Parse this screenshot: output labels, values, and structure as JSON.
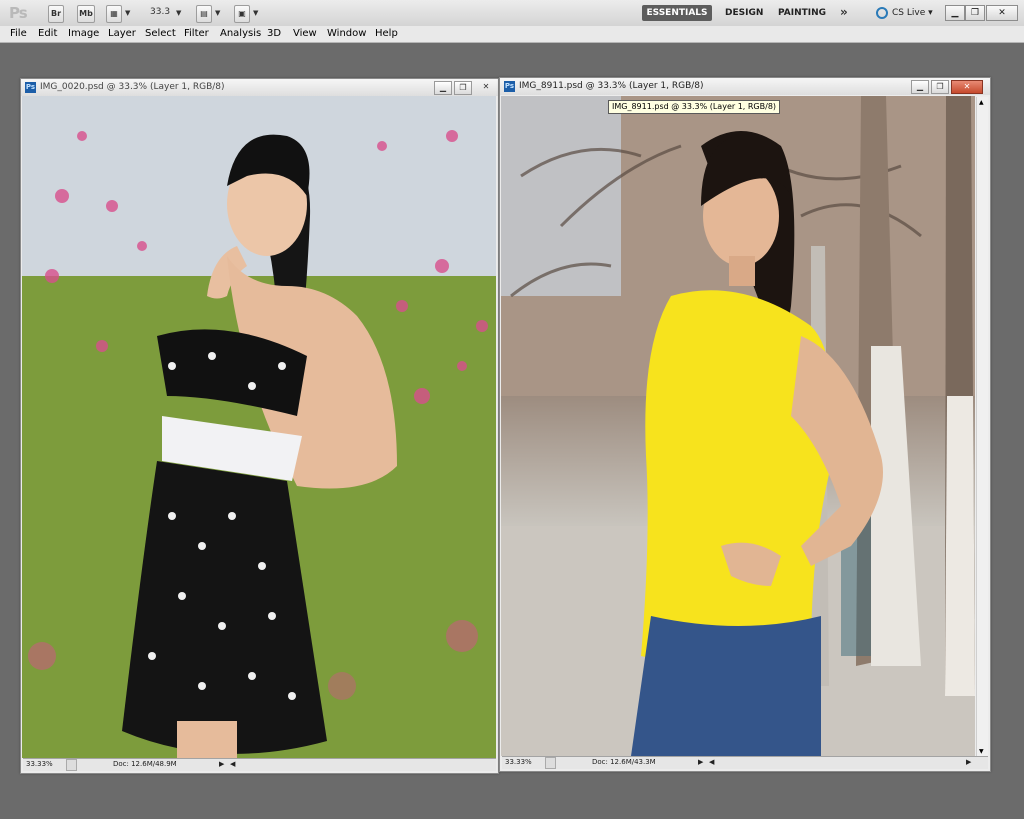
{
  "app": {
    "logo": "Ps",
    "zoom_value": "33.3",
    "toolbar_icons": [
      "br",
      "mb",
      "view-extras",
      "arrange-documents",
      "screen-mode"
    ],
    "workspace": {
      "active": "ESSENTIALS",
      "others": [
        "DESIGN",
        "PAINTING"
      ],
      "more": "»"
    },
    "cslive": "CS Live",
    "window_controls": [
      "minimize",
      "restore",
      "close"
    ]
  },
  "menu": [
    "File",
    "Edit",
    "Image",
    "Layer",
    "Select",
    "Filter",
    "Analysis",
    "3D",
    "View",
    "Window",
    "Help"
  ],
  "documents": [
    {
      "title": "IMG_0020.psd @ 33.3% (Layer 1, RGB/8)",
      "zoom": "33.33%",
      "doc_size": "Doc: 12.6M/48.9M",
      "active": false
    },
    {
      "title": "IMG_8911.psd @ 33.3% (Layer 1, RGB/8)",
      "zoom": "33.33%",
      "doc_size": "Doc: 12.6M/43.3M",
      "active": true
    }
  ],
  "tooltip": "IMG_8911.psd @ 33.3% (Layer 1, RGB/8)",
  "colors": {
    "accent_active_tab": "#5d5d5d",
    "workspace_bg": "#6b6b6b",
    "close_red": "#c64a2d",
    "cslive_blue": "#2a7ab8"
  }
}
